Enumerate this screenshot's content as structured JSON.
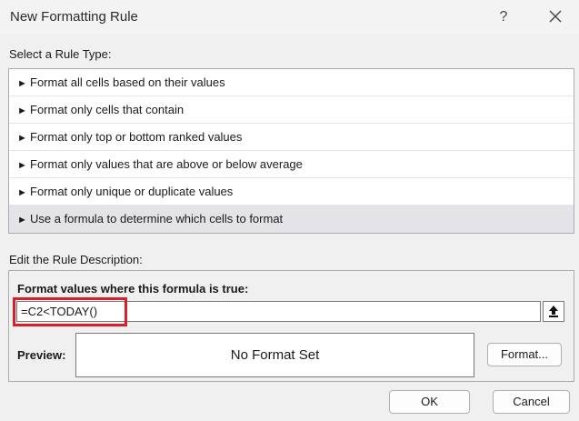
{
  "dialog": {
    "title": "New Formatting Rule",
    "help_label": "?",
    "close_icon": "close-icon"
  },
  "rule_type": {
    "label": "Select a Rule Type:",
    "arrow_glyph": "►",
    "items": [
      {
        "label": "Format all cells based on their values"
      },
      {
        "label": "Format only cells that contain"
      },
      {
        "label": "Format only top or bottom ranked values"
      },
      {
        "label": "Format only values that are above or below average"
      },
      {
        "label": "Format only unique or duplicate values"
      },
      {
        "label": "Use a formula to determine which cells to format"
      }
    ],
    "selected_index": 5
  },
  "rule_description": {
    "label": "Edit the Rule Description:",
    "heading": "Format values where this formula is true:",
    "formula_value": "=C2<TODAY()",
    "preview_label": "Preview:",
    "preview_text": "No Format Set",
    "format_button": "Format..."
  },
  "footer": {
    "ok_label": "OK",
    "cancel_label": "Cancel"
  },
  "colors": {
    "highlight": "#d6202c",
    "selected_row": "#e3e3e8"
  }
}
